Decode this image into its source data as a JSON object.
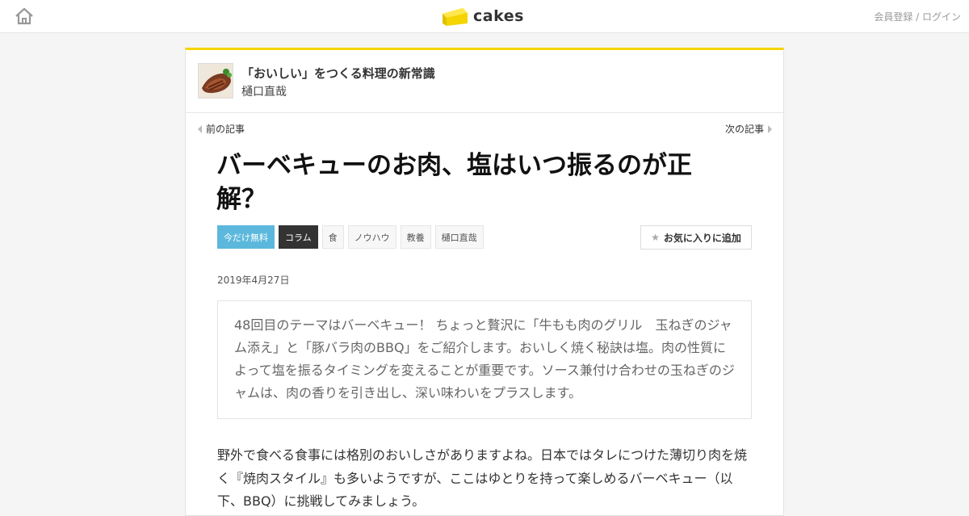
{
  "header": {
    "logo_text": "cakes",
    "auth_links": "会員登録 / ログイン",
    "accent_color": "#f5d400"
  },
  "series": {
    "title": "「おいしい」をつくる料理の新常識",
    "author": "樋口直哉"
  },
  "nav": {
    "prev_label": "前の記事",
    "next_label": "次の記事"
  },
  "article": {
    "title": "バーベキューのお肉、塩はいつ振るのが正解？",
    "tags": [
      {
        "label": "今だけ無料",
        "style": "free"
      },
      {
        "label": "コラム",
        "style": "column"
      },
      {
        "label": "食",
        "style": "plain"
      },
      {
        "label": "ノウハウ",
        "style": "plain"
      },
      {
        "label": "教養",
        "style": "plain"
      },
      {
        "label": "樋口直哉",
        "style": "plain"
      }
    ],
    "favorite_label": "お気に入りに追加",
    "date": "2019年4月27日",
    "lead": "48回目のテーマはバーベキュー！ ちょっと贅沢に「牛もも肉のグリル　玉ねぎのジャム添え」と「豚バラ肉のBBQ」をご紹介します。おいしく焼く秘訣は塩。肉の性質によって塩を振るタイミングを変えることが重要です。ソース兼付け合わせの玉ねぎのジャムは、肉の香りを引き出し、深い味わいをプラスします。",
    "body": "野外で食べる食事には格別のおいしさがありますよね。日本ではタレにつけた薄切り肉を焼く『焼肉スタイル』も多いようですが、ここはゆとりを持って楽しめるバーベキュー（以下、BBQ）に挑戦してみましょう。"
  }
}
